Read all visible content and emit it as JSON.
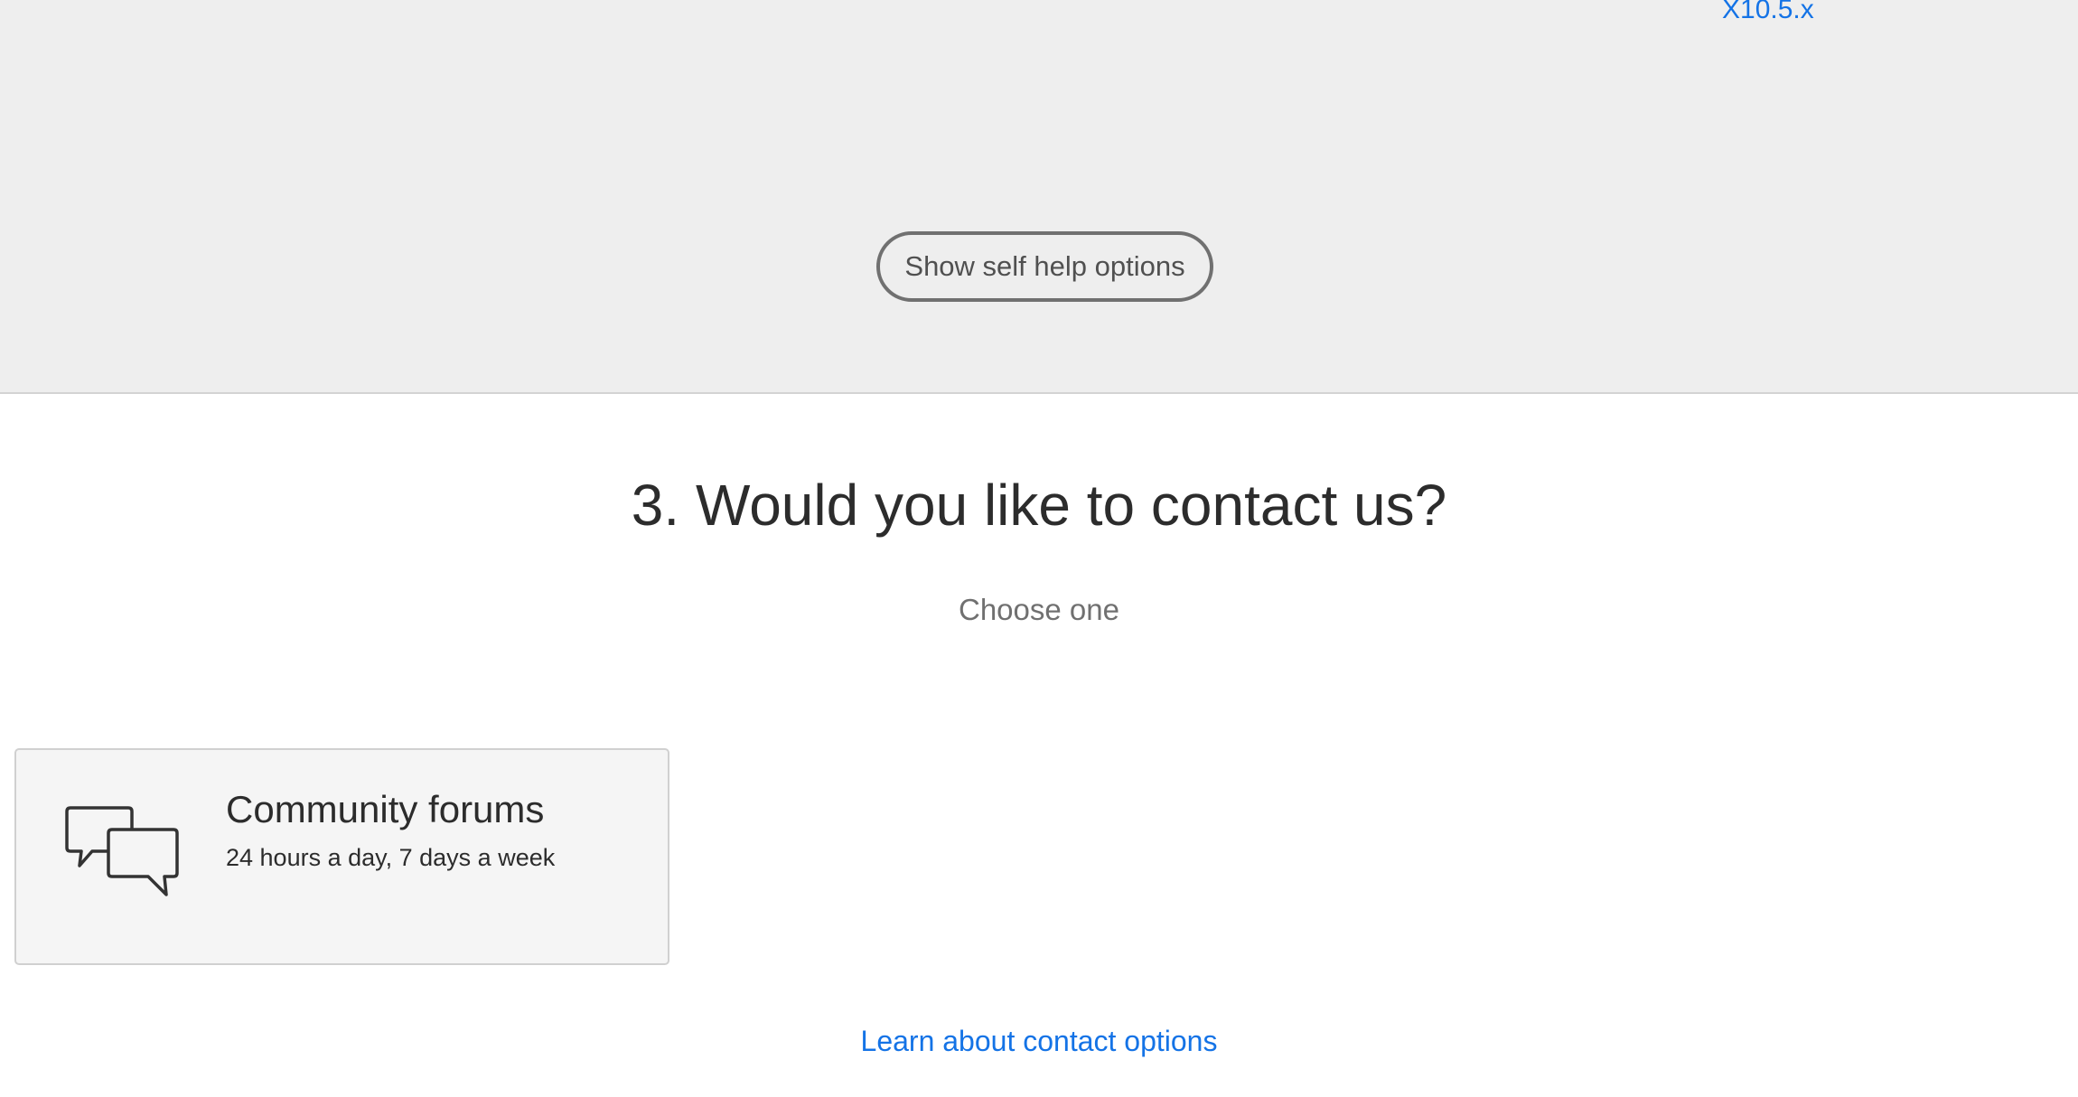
{
  "top_section": {
    "version_link": "X10.5.x",
    "self_help_button": "Show self help options"
  },
  "contact": {
    "heading": "3. Would you like to contact us?",
    "subheading": "Choose one",
    "options": [
      {
        "icon": "chat-bubbles-icon",
        "title": "Community forums",
        "subtitle": "24 hours a day, 7 days a week"
      }
    ],
    "learn_link": "Learn about contact options"
  },
  "colors": {
    "link": "#1473e6",
    "top_background": "#eeeeee",
    "card_background": "#f5f5f5",
    "heading_text": "#2c2c2c"
  }
}
